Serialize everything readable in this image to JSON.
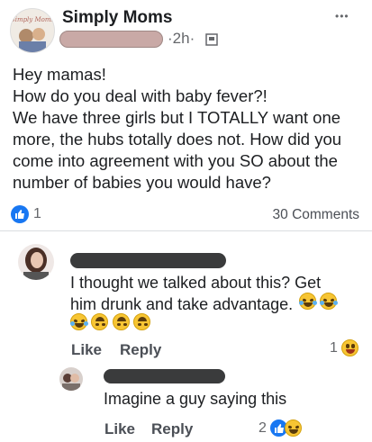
{
  "post": {
    "author": "Simply Moms",
    "time": "2h",
    "time_separator": "·",
    "menu_glyph": "•••",
    "text_lines": [
      "Hey mamas!",
      "How do you deal with baby fever?!",
      "We have three girls but I TOTALLY want one",
      "more, the hubs totally does not. How did you",
      "come into agreement with you SO about the",
      "number of babies you would have?"
    ],
    "reaction_count": "1",
    "comment_count": "30 Comments"
  },
  "comments": [
    {
      "text_lines": [
        "I thought we talked about this? Get",
        "him drunk and take advantage."
      ],
      "like_label": "Like",
      "reply_label": "Reply",
      "reaction_count": "1"
    }
  ],
  "reply": {
    "text": "Imagine a guy saying this",
    "like_label": "Like",
    "reply_label": "Reply",
    "reaction_count": "2"
  },
  "colors": {
    "like_blue": "#1877f2",
    "emoji_yellow": "#f7c533"
  },
  "icons": [
    "globe-privacy-icon",
    "more-options-icon",
    "like-reaction-icon",
    "laughing-emoji-icon",
    "grinning-emoji-icon"
  ]
}
